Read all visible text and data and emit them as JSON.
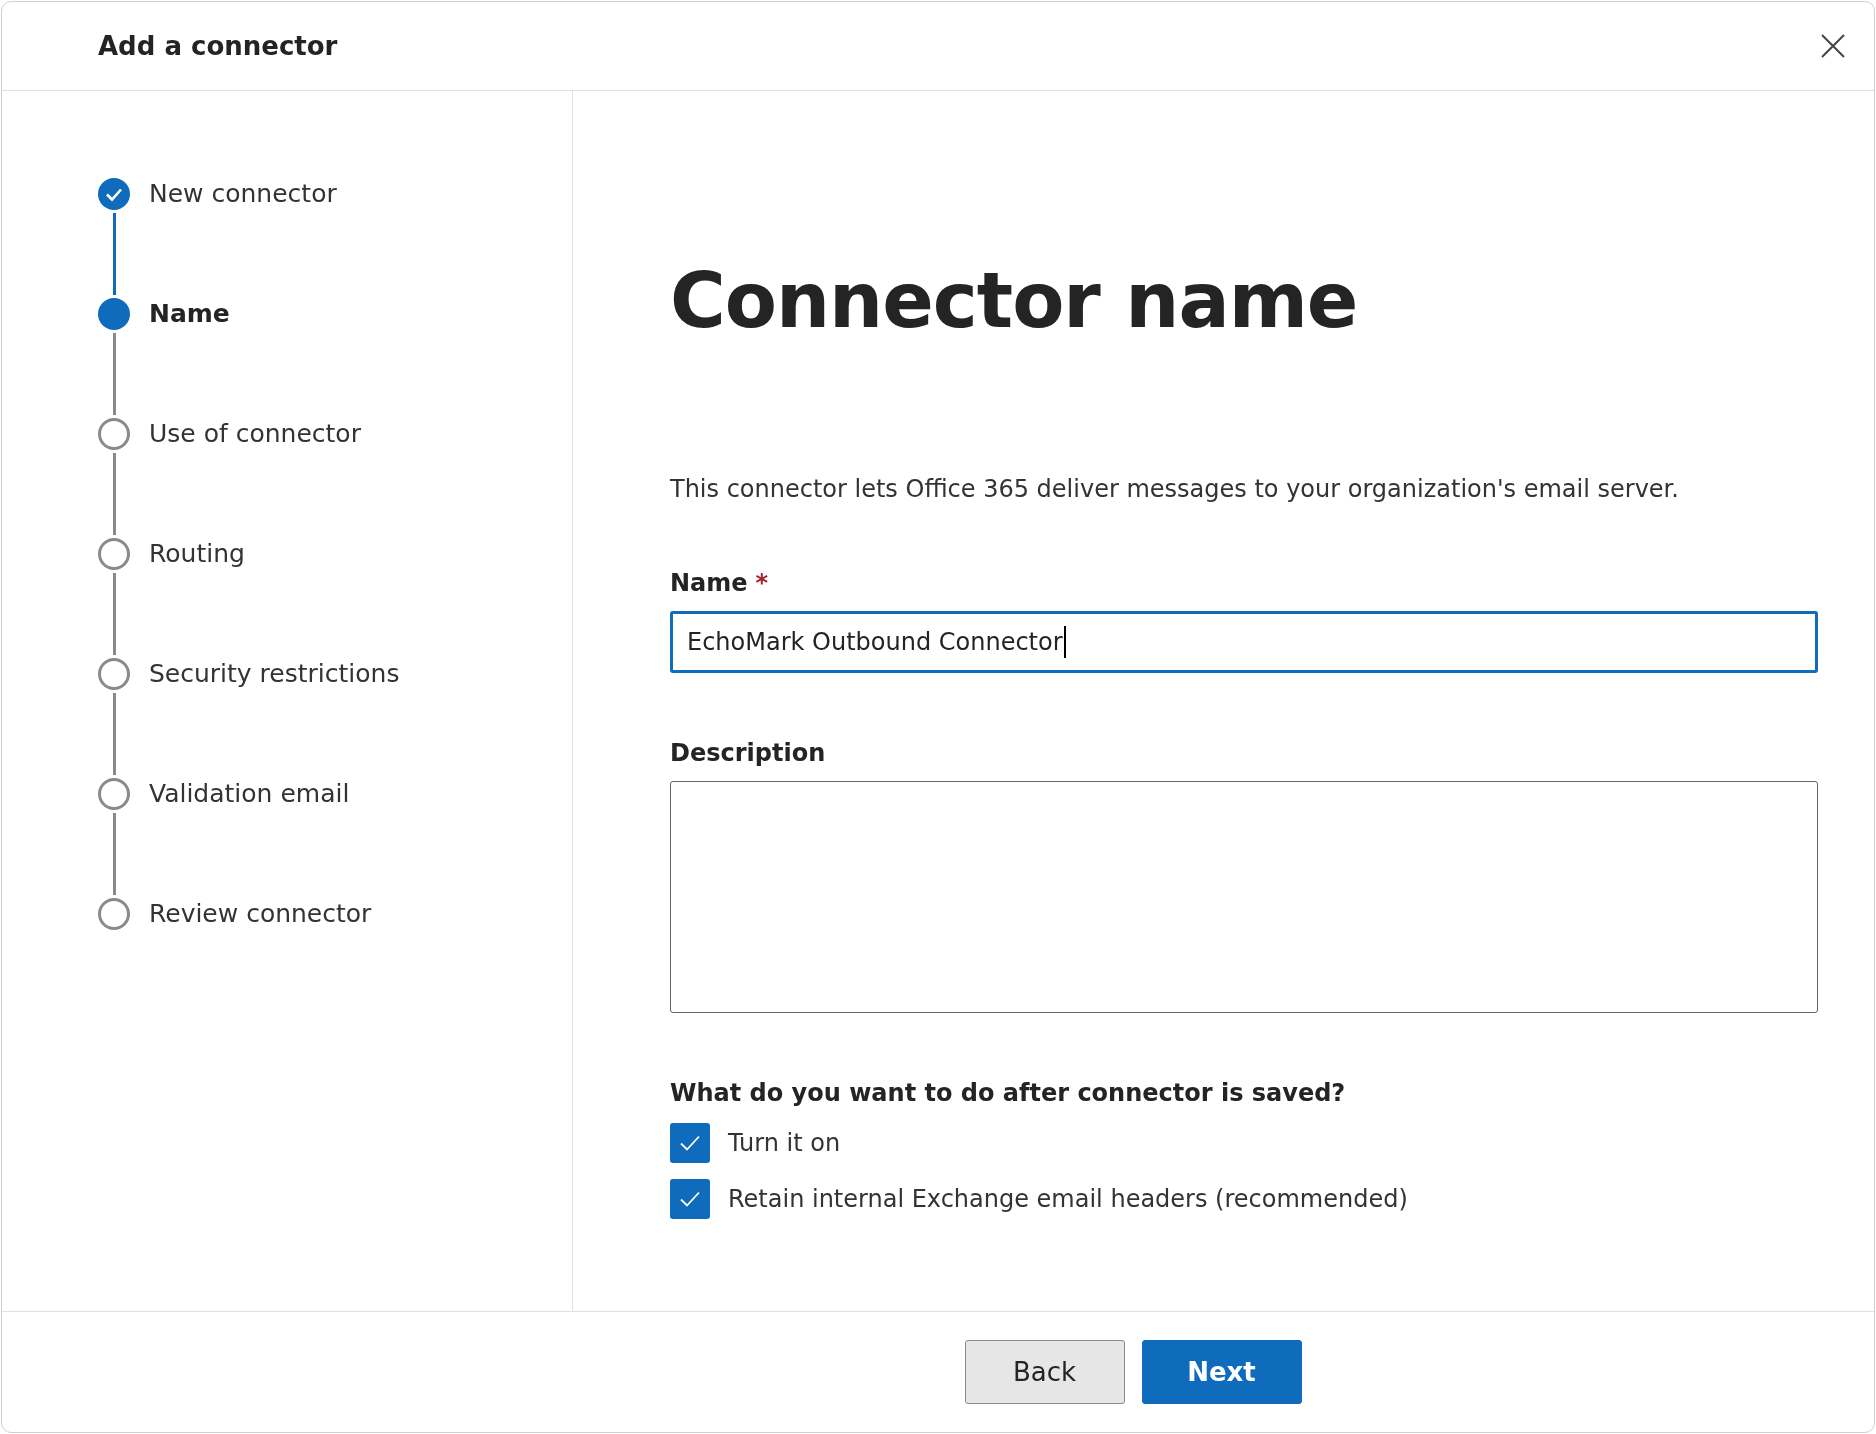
{
  "dialog": {
    "title": "Add a connector"
  },
  "steps": [
    {
      "label": "New connector",
      "completed": true,
      "selected": false
    },
    {
      "label": "Name",
      "completed": false,
      "selected": true
    },
    {
      "label": "Use of connector",
      "completed": false,
      "selected": false
    },
    {
      "label": "Routing",
      "completed": false,
      "selected": false
    },
    {
      "label": "Security restrictions",
      "completed": false,
      "selected": false
    },
    {
      "label": "Validation email",
      "completed": false,
      "selected": false
    },
    {
      "label": "Review connector",
      "completed": false,
      "selected": false
    }
  ],
  "heading": "Connector name",
  "intro": "This connector lets Office 365 deliver messages to your organization's email server.",
  "name_field": {
    "label": "Name",
    "required_mark": "*",
    "value": "EchoMark Outbound Connector"
  },
  "description_field": {
    "label": "Description"
  },
  "question": "What do you want to do after connector is saved?",
  "options": [
    {
      "label": "Turn it on",
      "checked": true
    },
    {
      "label": "Retain internal Exchange email headers (recommended)",
      "checked": true
    }
  ],
  "buttons": [
    {
      "label": "Back",
      "kind": "secondary"
    },
    {
      "label": "Next",
      "kind": "primary"
    }
  ]
}
